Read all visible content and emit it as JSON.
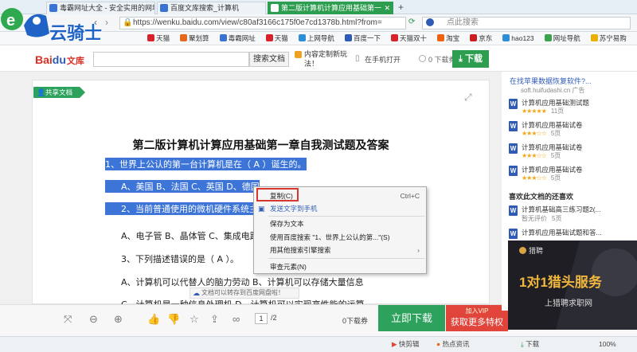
{
  "tabs": [
    {
      "label": "毒霸网址大全 - 安全实用的网址",
      "color": "#3b73d4",
      "active": false
    },
    {
      "label": "百度文库搜索_计算机",
      "color": "#3b73d4",
      "active": false
    },
    {
      "label": "第二版计算机计算应用基础第一",
      "color": "#ffffff",
      "active": true
    }
  ],
  "navbar": {
    "url": "https://wenku.baidu.com/view/c80af3166c175f0e7cd1378b.html?from=",
    "search_placeholder": "点此搜索"
  },
  "bookmarks": [
    {
      "label": "天猫",
      "color": "#d8232a"
    },
    {
      "label": "聚划算",
      "color": "#e66a1d"
    },
    {
      "label": "毒霸网址",
      "color": "#3b73d4"
    },
    {
      "label": "天猫",
      "color": "#d8232a"
    },
    {
      "label": "上网导航",
      "color": "#2e8fd6"
    },
    {
      "label": "百度一下",
      "color": "#2f5bb7"
    },
    {
      "label": "天猫双十",
      "color": "#d8232a"
    },
    {
      "label": "淘宝",
      "color": "#f1620f"
    },
    {
      "label": "京东",
      "color": "#cc1e1e"
    },
    {
      "label": "hao123",
      "color": "#2e8fd6"
    },
    {
      "label": "网址导航",
      "color": "#3aa34c"
    },
    {
      "label": "苏宁易购",
      "color": "#ecb000"
    }
  ],
  "logo": {
    "text": "云骑士",
    "badge": "e"
  },
  "wenku": {
    "brand_bai": "Bai",
    "brand_du": "du",
    "brand_wenku": "文库",
    "search_button": "搜索文档",
    "promo": "内容定制新玩法！",
    "open_in_phone": "在手机打开",
    "coupon": "0 下载券",
    "download": "下载"
  },
  "document": {
    "share_tag": "共享文档",
    "title": "第二版计算机计算应用基础第一章自我测试题及答案",
    "lines": [
      {
        "text": "1、世界上公认的第一台计算机是在（ A ）诞生的。",
        "selected": true
      },
      {
        "text": " ",
        "selected": true
      },
      {
        "text": "A、美国 B、法国 C、英国 D、德国",
        "selected": true
      },
      {
        "text": "2、当前普通使用的微机硬件系统主要由",
        "selected": true
      },
      {
        "text": "A、电子管 B、晶体管 C、集成电路 D",
        "selected": false
      },
      {
        "text": "3、下列描述错误的是（ A ）。",
        "selected": false
      },
      {
        "text": "A、计算机可以代替人的脑力劳动 B、计算机可以存储大量信息",
        "selected": false
      },
      {
        "text": "C、计算机是一种信息处理机 D、计算机可以实现高性能的运算",
        "selected": false
      }
    ],
    "toast": "文档可以转存到百度网盘啦！"
  },
  "context_menu": {
    "items": [
      {
        "label": "复制(C)",
        "shortcut": "Ctrl+C"
      },
      {
        "label": "发送文字到手机",
        "shortcut": ""
      },
      {
        "label": "保存为文本",
        "shortcut": ""
      },
      {
        "label": "使用百度搜索 \"1、世界上公认的第...\"(S)",
        "shortcut": ""
      },
      {
        "label": "用其他搜索引擎搜索",
        "shortcut": "›"
      },
      {
        "label": "审查元素(N)",
        "shortcut": ""
      }
    ]
  },
  "toolbar": {
    "page_current": "1",
    "page_total": "/2",
    "coupon": "0下载券",
    "download_now": "立即下载",
    "vip_top": "加入VIP",
    "vip_bottom": "获取更多特权"
  },
  "sidebar": {
    "ad_title": "在找苹果数据恢复软件?...",
    "ad_url": "soft.huifudashi.cn",
    "ad_tag": "广告",
    "docs": [
      {
        "title": "计算机应用基础测试题",
        "stars": 5,
        "pages": "11页"
      },
      {
        "title": "计算机应用基础试卷",
        "stars": 3,
        "pages": "5页"
      },
      {
        "title": "计算机应用基础试卷",
        "stars": 3,
        "pages": "5页"
      },
      {
        "title": "计算机应用基础试卷",
        "stars": 3,
        "pages": "5页"
      }
    ],
    "section_title": "喜欢此文档的还喜欢",
    "liked": [
      {
        "title": "计算机基础高三练习题2(...",
        "meta": "暂无评价",
        "pages": "5页"
      },
      {
        "title": "计算机应用基础试题和答...",
        "meta": "",
        "pages": ""
      }
    ]
  },
  "ad_banner": {
    "brand": "猎聘",
    "headline": "1对1猎头服务",
    "sub": "上猎聘求职网"
  },
  "statusbar": {
    "items": [
      "快剪辑",
      "热点资讯",
      "下载",
      "100%"
    ]
  }
}
